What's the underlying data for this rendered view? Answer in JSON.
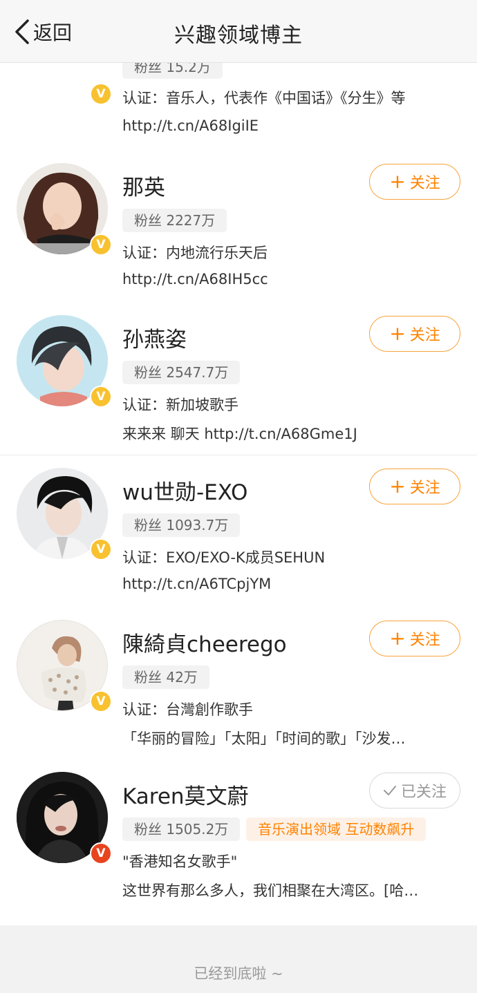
{
  "nav": {
    "back_label": "返回",
    "title": "兴趣领域博主"
  },
  "users": [
    {
      "name": "",
      "fans": "粉丝 15.2万",
      "line1": "认证：音乐人，代表作《中国话》《分生》等",
      "line2": "http://t.cn/A68IgiIE",
      "verified": "gold",
      "avatar_icon": "piano-avatar"
    },
    {
      "name": "那英",
      "fans": "粉丝 2227万",
      "line1": "认证：内地流行乐天后",
      "line2": "http://t.cn/A68IH5cc",
      "verified": "gold",
      "follow_label": "关注",
      "avatar_icon": "portrait-avatar"
    },
    {
      "name": "孙燕姿",
      "fans": "粉丝 2547.7万",
      "line1": "认证：新加坡歌手",
      "line2": "来来来 聊天 http://t.cn/A68Gme1J",
      "verified": "gold",
      "follow_label": "关注",
      "avatar_icon": "portrait-avatar"
    },
    {
      "name": "wu世勋-EXO",
      "fans": "粉丝 1093.7万",
      "line1": "认证：EXO/EXO-K成员SEHUN",
      "line2": "http://t.cn/A6TCpjYM",
      "verified": "gold",
      "follow_label": "关注",
      "avatar_icon": "portrait-avatar"
    },
    {
      "name": "陳綺貞cheerego",
      "fans": "粉丝 42万",
      "line1": "认证：台灣創作歌手",
      "line2": "「华丽的冒险」「太阳」「时间的歌」「沙发…",
      "verified": "gold",
      "follow_label": "关注",
      "avatar_icon": "portrait-avatar"
    },
    {
      "name": "Karen莫文蔚",
      "fans": "粉丝 1505.2万",
      "tag": "音乐演出领域 互动数飙升",
      "line1": "\"香港知名女歌手\"",
      "line2": "这世界有那么多人，我们相聚在大湾区。[哈…",
      "verified": "red",
      "followed_label": "已关注",
      "avatar_icon": "portrait-avatar"
    }
  ],
  "colors": {
    "accent": "#ff8200",
    "badge_gold": "#f8c12f",
    "badge_red": "#e8441e"
  },
  "footer": {
    "text": "已经到底啦 ~"
  }
}
